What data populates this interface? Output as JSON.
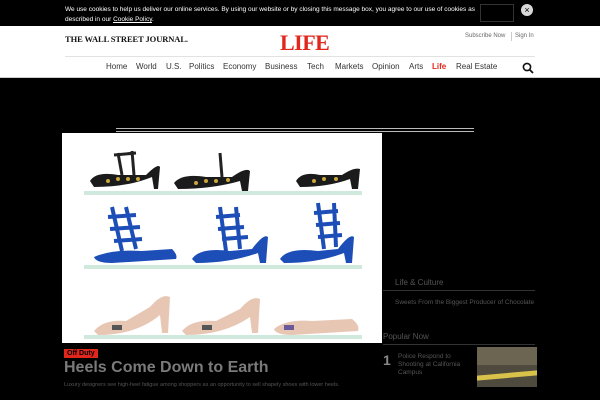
{
  "cookie_banner": {
    "text_before_link": "We use cookies to help us deliver our online services. By using our website or by closing this message box, you agree to our use of cookies as described in our ",
    "link_text": "Cookie Policy",
    "text_after_link": ".",
    "close_icon": "×"
  },
  "header": {
    "masthead": "THE WALL STREET JOURNAL.",
    "section_logo": "LIFE",
    "subscribe": "Subscribe Now",
    "sign_in": "Sign In"
  },
  "nav": {
    "items": [
      "Home",
      "World",
      "U.S.",
      "Politics",
      "Economy",
      "Business",
      "Tech",
      "Markets",
      "Opinion",
      "Arts",
      "Life",
      "Real Estate"
    ],
    "active": "Life"
  },
  "article": {
    "badge": "Off Duty",
    "headline": "Heels Come Down to Earth",
    "dek": "Luxury designers see high-heel fatigue among shoppers as an opportunity to sell shapely shoes with lower heels."
  },
  "sidebar": {
    "heading_1": "Life & Culture",
    "item_1": "Sweets From the Biggest Producer of Chocolate",
    "heading_2": "Popular Now",
    "item_2_number": "1",
    "item_2": "Police Respond to Shooting at California Campus"
  },
  "colors": {
    "brand_red": "#e1261c",
    "page_bg": "#000000",
    "header_bg": "#ffffff"
  }
}
